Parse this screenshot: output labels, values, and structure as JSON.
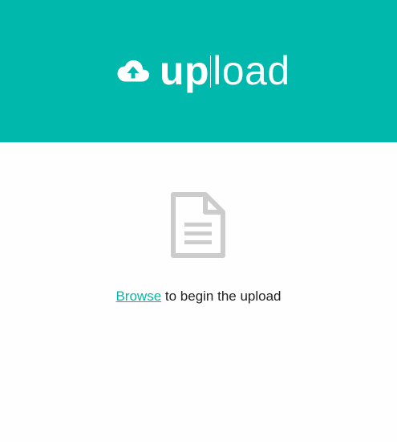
{
  "header": {
    "icon": "cloud-upload-icon",
    "title_strong": "up",
    "title_light": "load",
    "background_color": "#00b8ab"
  },
  "main": {
    "icon": "document-icon",
    "browse_link": "Browse",
    "prompt_rest": " to begin the upload",
    "link_color": "#00b8ab"
  }
}
